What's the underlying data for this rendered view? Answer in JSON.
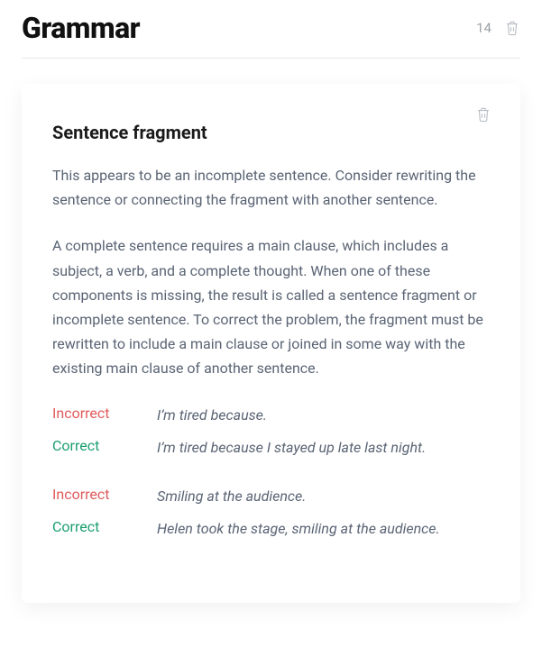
{
  "header": {
    "title": "Grammar",
    "count": "14"
  },
  "card": {
    "title": "Sentence fragment",
    "intro": "This appears to be an incomplete sentence. Consider rewriting the sentence or connecting the fragment with another sentence.",
    "detail": "A complete sentence requires a main clause, which includes a subject, a verb, and a complete thought. When one of these components is missing, the result is called a sentence fragment or incomplete sentence. To correct the problem, the fragment must be rewritten to include a main clause or joined in some way with the existing main clause of another sentence.",
    "labels": {
      "incorrect": "Incorrect",
      "correct": "Correct"
    },
    "examples": [
      {
        "incorrect": "I’m tired because.",
        "correct": "I’m tired because I stayed up late last night."
      },
      {
        "incorrect": "Smiling at the audience.",
        "correct": "Helen took the stage, smiling at the audience."
      }
    ]
  }
}
